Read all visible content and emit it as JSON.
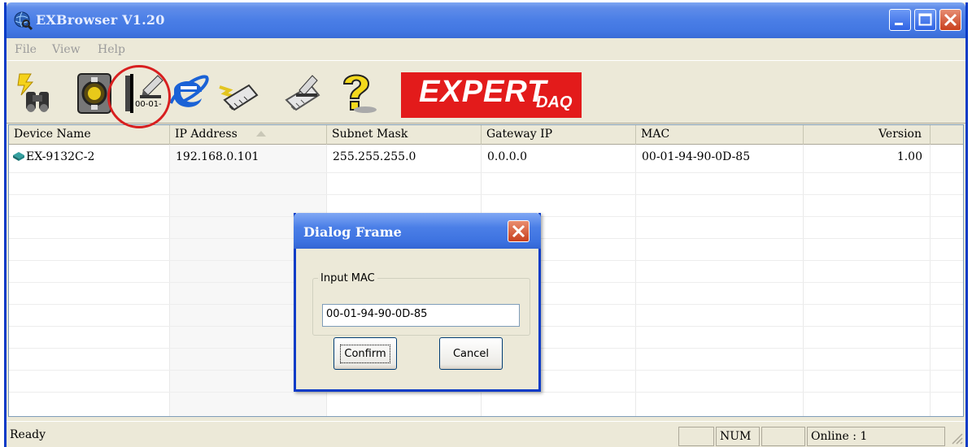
{
  "window": {
    "title": "EXBrowser V1.20"
  },
  "menu": [
    "File",
    "View",
    "Help"
  ],
  "toolbar": {
    "tools": [
      "search-devices-icon",
      "configure-icon",
      "set-mac-icon",
      "internet-explorer-icon",
      "firmware-update-icon",
      "write-icon",
      "help-icon"
    ],
    "set_mac_caption": "00-01-",
    "logo_text": "EXPERT",
    "logo_sub": "DAQ"
  },
  "table": {
    "columns": [
      "Device Name",
      "IP Address",
      "Subnet Mask",
      "Gateway IP",
      "MAC",
      "Version"
    ],
    "rows": [
      {
        "device": "EX-9132C-2",
        "ip": "192.168.0.101",
        "mask": "255.255.255.0",
        "gateway": "0.0.0.0",
        "mac": "00-01-94-90-0D-85",
        "version": "1.00"
      }
    ]
  },
  "dialog": {
    "title": "Dialog Frame",
    "group_label": "Input MAC",
    "mac_value": "00-01-94-90-0D-85",
    "confirm_label": "Confirm",
    "cancel_label": "Cancel"
  },
  "status": {
    "text": "Ready",
    "num": "NUM",
    "online": "Online : 1"
  },
  "colors": {
    "title_blue": "#0a3bc7",
    "highlight_red": "#d81f1f",
    "logo_red": "#e31b1b"
  }
}
